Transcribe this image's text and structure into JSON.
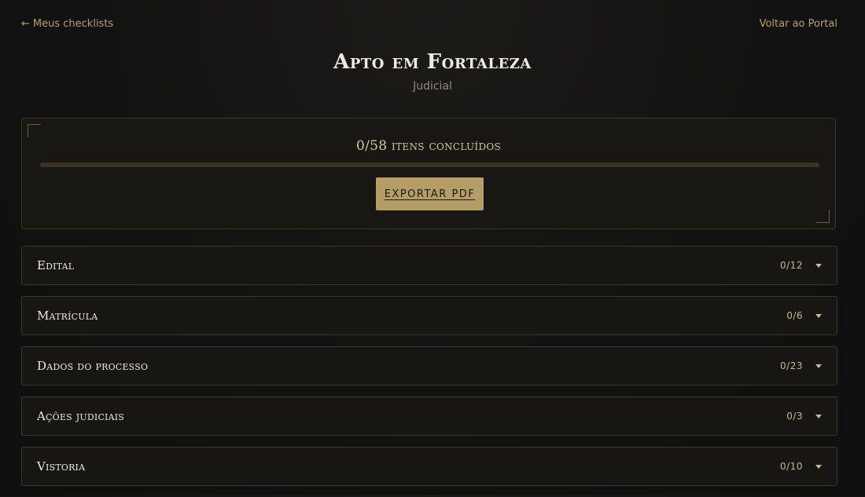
{
  "nav": {
    "back_arrow": "←",
    "back_label": "Meus checklists",
    "portal_label": "Voltar ao Portal"
  },
  "header": {
    "title": "Apto em Fortaleza",
    "subtitle": "Judicial"
  },
  "progress": {
    "label": "0/58 itens concluídos",
    "fraction": 0,
    "export_label": "EXPORTAR PDF"
  },
  "sections": [
    {
      "title": "Edital",
      "count": "0/12"
    },
    {
      "title": "Matrícula",
      "count": "0/6"
    },
    {
      "title": "Dados do processo",
      "count": "0/23"
    },
    {
      "title": "Ações judiciais",
      "count": "0/3"
    },
    {
      "title": "Vistoria",
      "count": "0/10"
    }
  ],
  "colors": {
    "accent": "#b59d67",
    "background": "#121212",
    "card": "#181713",
    "border": "#3b3626"
  }
}
